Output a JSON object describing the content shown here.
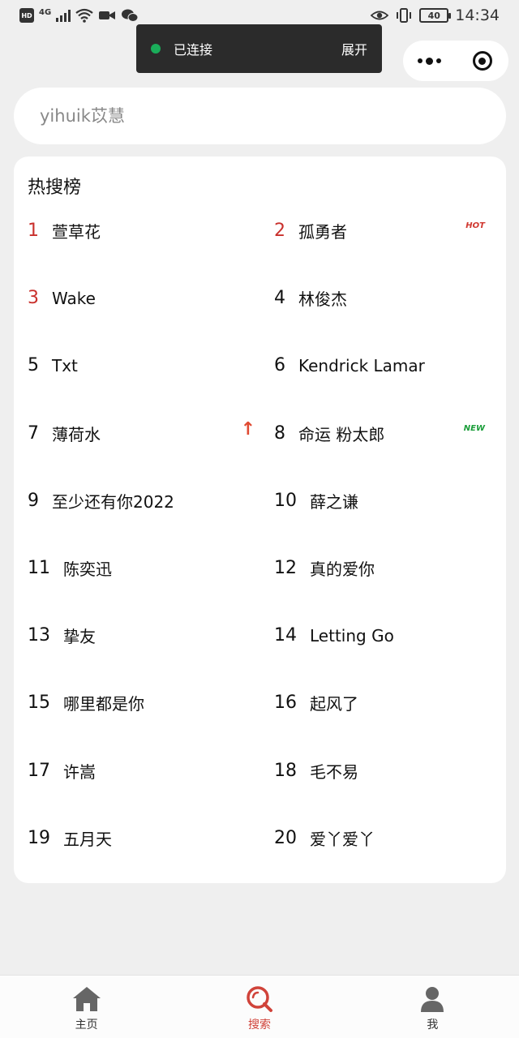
{
  "status_bar": {
    "network": "4G",
    "battery": "40",
    "time": "14:34"
  },
  "toast": {
    "text": "已连接",
    "action": "展开"
  },
  "search": {
    "placeholder": "yihuik苡慧"
  },
  "hot_list": {
    "title": "热搜榜",
    "items": [
      {
        "rank": "1",
        "name": "萱草花",
        "highlight": true,
        "tag": ""
      },
      {
        "rank": "2",
        "name": "孤勇者",
        "highlight": true,
        "tag": "HOT"
      },
      {
        "rank": "3",
        "name": "Wake",
        "highlight": true,
        "tag": ""
      },
      {
        "rank": "4",
        "name": "林俊杰",
        "highlight": false,
        "tag": ""
      },
      {
        "rank": "5",
        "name": "Txt",
        "highlight": false,
        "tag": ""
      },
      {
        "rank": "6",
        "name": "Kendrick Lamar",
        "highlight": false,
        "tag": ""
      },
      {
        "rank": "7",
        "name": "薄荷水",
        "highlight": false,
        "tag": "up-arrow-icon"
      },
      {
        "rank": "8",
        "name": "命运 粉太郎",
        "highlight": false,
        "tag": "NEW"
      },
      {
        "rank": "9",
        "name": "至少还有你2022",
        "highlight": false,
        "tag": ""
      },
      {
        "rank": "10",
        "name": "薛之谦",
        "highlight": false,
        "tag": ""
      },
      {
        "rank": "11",
        "name": "陈奕迅",
        "highlight": false,
        "tag": ""
      },
      {
        "rank": "12",
        "name": "真的爱你",
        "highlight": false,
        "tag": ""
      },
      {
        "rank": "13",
        "name": "挚友",
        "highlight": false,
        "tag": ""
      },
      {
        "rank": "14",
        "name": "Letting Go",
        "highlight": false,
        "tag": ""
      },
      {
        "rank": "15",
        "name": "哪里都是你",
        "highlight": false,
        "tag": ""
      },
      {
        "rank": "16",
        "name": "起风了",
        "highlight": false,
        "tag": ""
      },
      {
        "rank": "17",
        "name": "许嵩",
        "highlight": false,
        "tag": ""
      },
      {
        "rank": "18",
        "name": "毛不易",
        "highlight": false,
        "tag": ""
      },
      {
        "rank": "19",
        "name": "五月天",
        "highlight": false,
        "tag": ""
      },
      {
        "rank": "20",
        "name": "爱丫爱丫",
        "highlight": false,
        "tag": ""
      }
    ]
  },
  "tab_bar": {
    "tabs": [
      {
        "label": "主页",
        "icon": "home-icon",
        "active": false
      },
      {
        "label": "搜索",
        "icon": "search-icon",
        "active": true
      },
      {
        "label": "我",
        "icon": "user-icon",
        "active": false
      }
    ]
  },
  "colors": {
    "top_rank": "#c9302c",
    "active_tab": "#d0433a",
    "hot_tag": "#d0372f",
    "new_tag": "#1b9e3a",
    "toast_dot": "#1aad5a"
  }
}
